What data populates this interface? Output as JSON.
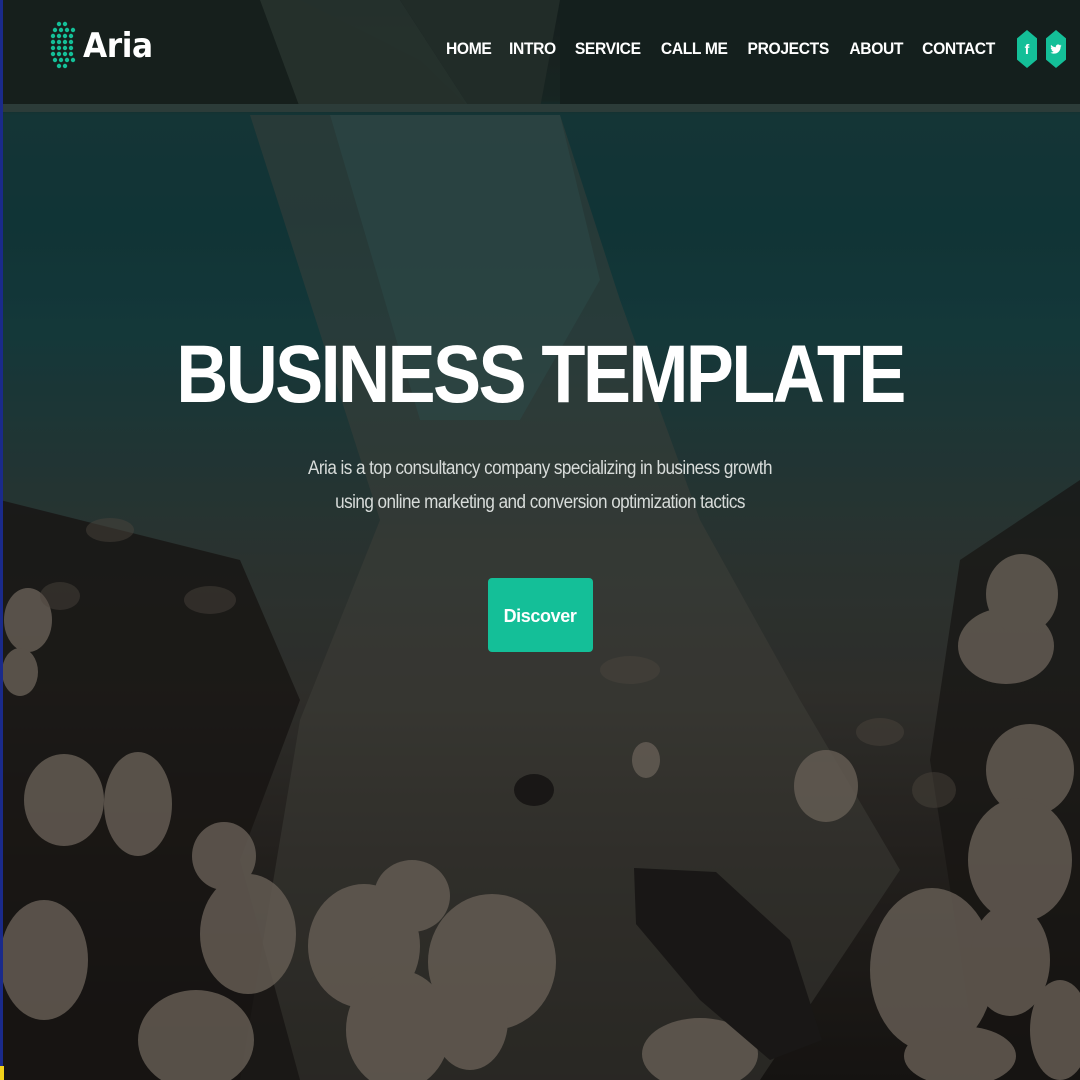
{
  "brand": {
    "name": "Aria",
    "logo_icon": "dotted-sphere-icon"
  },
  "nav": {
    "items": [
      "HOME",
      "INTRO",
      "SERVICE",
      "CALL ME",
      "PROJECTS",
      "ABOUT",
      "CONTACT"
    ],
    "social": [
      {
        "icon": "facebook-icon",
        "glyph": "f"
      },
      {
        "icon": "twitter-icon",
        "glyph": ""
      }
    ]
  },
  "hero": {
    "title": "BUSINESS TEMPLATE",
    "subtitle": "Aria is a top consultancy company specializing in business growth using online marketing and conversion optimization tactics",
    "cta_label": "Discover"
  },
  "colors": {
    "accent": "#14bf98",
    "text": "#ffffff",
    "subtext": "#d8dcda"
  }
}
